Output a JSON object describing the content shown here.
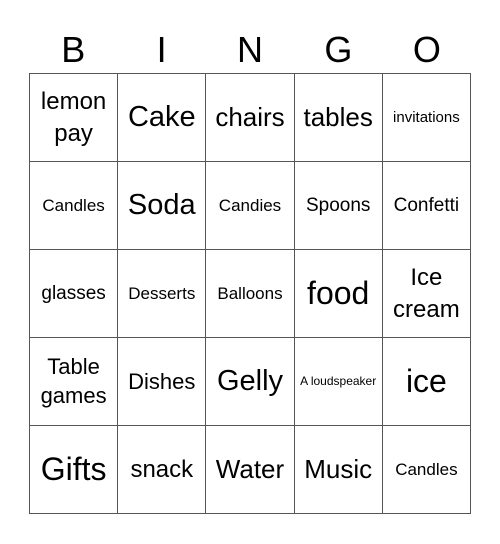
{
  "header": [
    "B",
    "I",
    "N",
    "G",
    "O"
  ],
  "cells": [
    [
      "lemon pay",
      "Cake",
      "chairs",
      "tables",
      "invitations"
    ],
    [
      "Candles",
      "Soda",
      "Candies",
      "Spoons",
      "Confetti"
    ],
    [
      "glasses",
      "Desserts",
      "Balloons",
      "food",
      "Ice cream"
    ],
    [
      "Table games",
      "Dishes",
      "Gelly",
      "A loudspeaker",
      "ice"
    ],
    [
      "Gifts",
      "snack",
      "Water",
      "Music",
      "Candles"
    ]
  ]
}
